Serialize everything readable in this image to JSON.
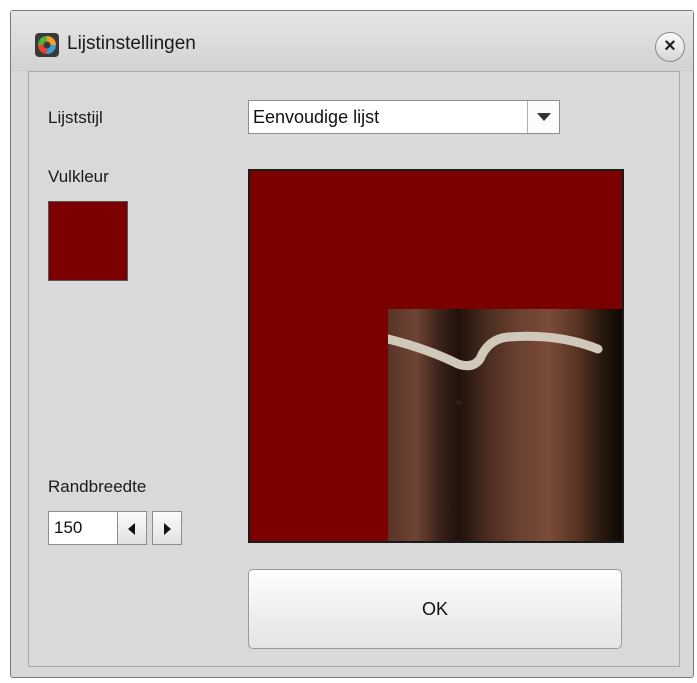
{
  "window": {
    "title": "Lijstinstellingen",
    "app_icon": "photo-app-icon",
    "close_label": "×"
  },
  "frame_style": {
    "label": "Lijststijl",
    "selected": "Eenvoudige lijst",
    "arrow_icon": "chevron-down-icon"
  },
  "fill_color": {
    "label": "Vulkleur",
    "color": "#7b0000"
  },
  "border_width": {
    "label": "Randbreedte",
    "value": "150",
    "decrease_icon": "arrow-left-icon",
    "increase_icon": "arrow-right-icon"
  },
  "preview": {
    "frame_color": "#7b0000"
  },
  "ok_label": "OK"
}
